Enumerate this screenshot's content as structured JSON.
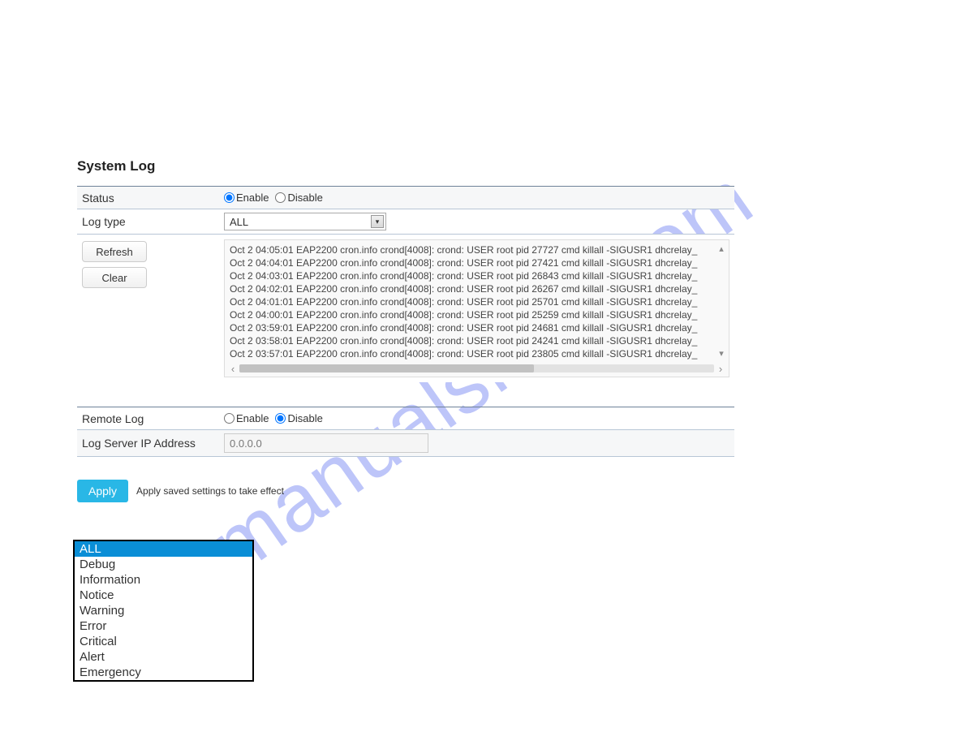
{
  "page_title": "System Log",
  "status": {
    "label": "Status",
    "enable_label": "Enable",
    "disable_label": "Disable",
    "selected": "enable"
  },
  "logtype": {
    "label": "Log type",
    "selected": "ALL",
    "options": [
      "ALL",
      "Debug",
      "Information",
      "Notice",
      "Warning",
      "Error",
      "Critical",
      "Alert",
      "Emergency"
    ]
  },
  "buttons": {
    "refresh": "Refresh",
    "clear": "Clear"
  },
  "log_entries": [
    "Oct  2 04:05:01 EAP2200 cron.info crond[4008]: crond: USER root pid 27727 cmd killall -SIGUSR1 dhcrelay_",
    "Oct  2 04:04:01 EAP2200 cron.info crond[4008]: crond: USER root pid 27421 cmd killall -SIGUSR1 dhcrelay_",
    "Oct  2 04:03:01 EAP2200 cron.info crond[4008]: crond: USER root pid 26843 cmd killall -SIGUSR1 dhcrelay_",
    "Oct  2 04:02:01 EAP2200 cron.info crond[4008]: crond: USER root pid 26267 cmd killall -SIGUSR1 dhcrelay_",
    "Oct  2 04:01:01 EAP2200 cron.info crond[4008]: crond: USER root pid 25701 cmd killall -SIGUSR1 dhcrelay_",
    "Oct  2 04:00:01 EAP2200 cron.info crond[4008]: crond: USER root pid 25259 cmd killall -SIGUSR1 dhcrelay_",
    "Oct  2 03:59:01 EAP2200 cron.info crond[4008]: crond: USER root pid 24681 cmd killall -SIGUSR1 dhcrelay_",
    "Oct  2 03:58:01 EAP2200 cron.info crond[4008]: crond: USER root pid 24241 cmd killall -SIGUSR1 dhcrelay_",
    "Oct  2 03:57:01 EAP2200 cron.info crond[4008]: crond: USER root pid 23805 cmd killall -SIGUSR1 dhcrelay_"
  ],
  "remote_log": {
    "label": "Remote Log",
    "enable_label": "Enable",
    "disable_label": "Disable",
    "selected": "disable"
  },
  "log_server": {
    "label": "Log Server IP Address",
    "value": "0.0.0.0"
  },
  "apply": {
    "button": "Apply",
    "note": "Apply saved settings to take effect"
  },
  "watermark": "manualshelf.com"
}
